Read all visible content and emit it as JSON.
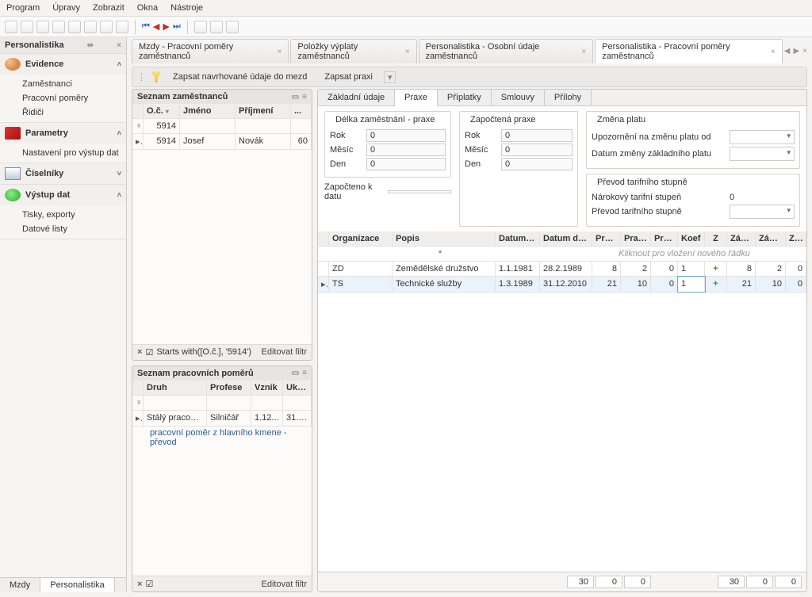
{
  "menu": {
    "items": [
      "Program",
      "Úpravy",
      "Zobrazit",
      "Okna",
      "Nástroje"
    ]
  },
  "sidebar": {
    "title": "Personalistika",
    "sections": [
      {
        "title": "Evidence",
        "items": [
          "Zaměstnanci",
          "Pracovní poměry",
          "Řidiči"
        ],
        "expanded": true
      },
      {
        "title": "Parametry",
        "items": [
          "Nastavení pro výstup dat"
        ],
        "expanded": true
      },
      {
        "title": "Číselníky",
        "items": [],
        "expanded": false
      },
      {
        "title": "Výstup dat",
        "items": [
          "Tisky, exporty",
          "Datové listy"
        ],
        "expanded": true
      }
    ]
  },
  "doc_tabs": [
    "Mzdy - Pracovní poměry zaměstnanců",
    "Položky výplaty zaměstnanců",
    "Personalistika - Osobní údaje zaměstnanců",
    "Personalistika - Pracovní poměry zaměstnanců"
  ],
  "actions": {
    "zapsat_mezd": "Zapsat navrhované údaje do mezd",
    "zapsat_praxi": "Zapsat praxi"
  },
  "emp_panel": {
    "title": "Seznam zaměstnanců",
    "headers": {
      "oc": "O.č.",
      "jmeno": "Jméno",
      "prijmeni": "Příjmení",
      "dots": "..."
    },
    "filter_row": {
      "oc": "5914"
    },
    "rows": [
      {
        "oc": "5914",
        "jmeno": "Josef",
        "prijmeni": "Novák",
        "extra": "60"
      }
    ],
    "filter_text": "Starts with([O.č.], '5914')",
    "edit_filter": "Editovat filtr"
  },
  "pom_panel": {
    "title": "Seznam pracovních poměrů",
    "headers": {
      "druh": "Druh",
      "profese": "Profese",
      "vznik": "Vznik",
      "uko": "Uko..."
    },
    "rows": [
      {
        "druh": "Stálý pracovní p...",
        "profese": "Silničář",
        "vznik": "1.12...",
        "uko": "31.1..."
      }
    ],
    "note": "pracovní poměr z hlavního kmene - převod",
    "edit_filter": "Editovat filtr"
  },
  "sub_tabs": [
    "Základní údaje",
    "Praxe",
    "Příplatky",
    "Smlouvy",
    "Přílohy"
  ],
  "forms": {
    "delka": {
      "title": "Délka zaměstnání - praxe",
      "rok_lbl": "Rok",
      "rok": "0",
      "mesic_lbl": "Měsíc",
      "mesic": "0",
      "den_lbl": "Den",
      "den": "0",
      "zapocteno_lbl": "Započteno k datu"
    },
    "zapoctena": {
      "title": "Započtená praxe",
      "rok_lbl": "Rok",
      "rok": "0",
      "mesic_lbl": "Měsíc",
      "mesic": "0",
      "den_lbl": "Den",
      "den": "0"
    },
    "zmena": {
      "title": "Změna platu",
      "upoz_lbl": "Upozornění na změnu platu od",
      "datum_lbl": "Datum změny základního platu"
    },
    "prevod": {
      "title": "Převod tarifního stupně",
      "narok_lbl": "Nárokový tarifní stupeň",
      "narok": "0",
      "prevod_lbl": "Převod tarifního stupně"
    }
  },
  "dg": {
    "headers": {
      "org": "Organizace",
      "popis": "Popis",
      "od": "Datum od",
      "do": "Datum do",
      "proku": "Praxe roků",
      "pmes": "Praxe měsíců",
      "pdnu": "Praxe dnů",
      "koef": "Koef",
      "z": "Z",
      "zroku": "Záp. roků",
      "zmes": "Záp. měsíců",
      "zdnu": "Záp. dnů"
    },
    "newrow": "Kliknout pro vložení nového řádku",
    "rows": [
      {
        "org": "ZD",
        "popis": "Zemědělské družstvo",
        "od": "1.1.1981",
        "do": "28.2.1989",
        "proku": "8",
        "pmes": "2",
        "pdnu": "0",
        "koef": "1",
        "zroku": "8",
        "zmes": "2",
        "zdnu": "0"
      },
      {
        "org": "TS",
        "popis": "Technické služby",
        "od": "1.3.1989",
        "do": "31.12.2010",
        "proku": "21",
        "pmes": "10",
        "pdnu": "0",
        "koef": "1",
        "zroku": "21",
        "zmes": "10",
        "zdnu": "0"
      }
    ],
    "summary_left": [
      "30",
      "0",
      "0"
    ],
    "summary_right": [
      "30",
      "0",
      "0"
    ]
  },
  "bottom": {
    "mzdy": "Mzdy",
    "pers": "Personalistika"
  }
}
